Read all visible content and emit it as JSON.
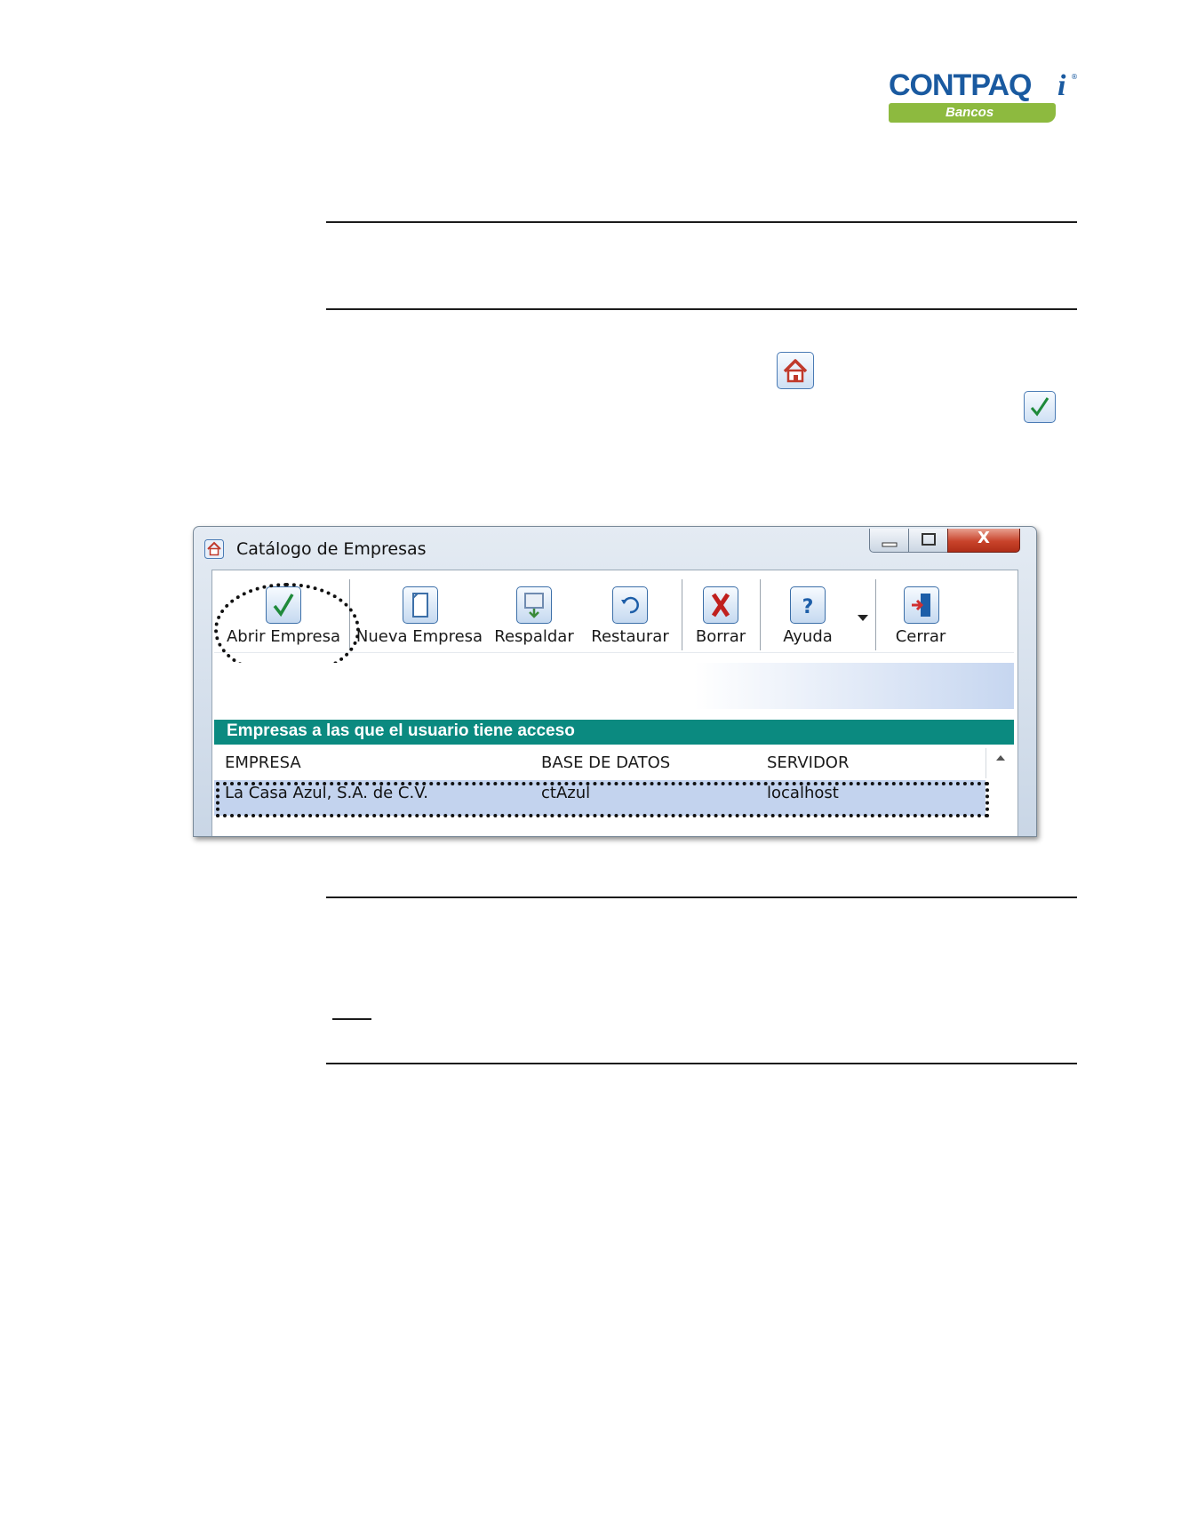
{
  "logo": {
    "word": "CONTPAQ",
    "i": "i",
    "tm": "®",
    "product": "Bancos"
  },
  "window": {
    "title": "Catálogo de Empresas",
    "close_glyph": "X",
    "toolbar": [
      {
        "id": "abrir",
        "label": "Abrir Empresa",
        "icon": "check-icon",
        "color": "#1f8a3a"
      },
      {
        "id": "nueva",
        "label": "Nueva Empresa",
        "icon": "new-document-icon",
        "color": "#3c6fa8"
      },
      {
        "id": "respaldar",
        "label": "Respaldar",
        "icon": "backup-icon",
        "color": "#3a8a3a"
      },
      {
        "id": "restaurar",
        "label": "Restaurar",
        "icon": "restore-icon",
        "color": "#1d5ea8"
      },
      {
        "id": "borrar",
        "label": "Borrar",
        "icon": "delete-x-icon",
        "color": "#c0201e"
      },
      {
        "id": "ayuda",
        "label": "Ayuda",
        "icon": "help-icon",
        "color": "#1d5ea8"
      },
      {
        "id": "cerrar",
        "label": "Cerrar",
        "icon": "exit-door-icon",
        "color": "#1d5ea8"
      }
    ],
    "grid": {
      "caption": "Empresas a las que el usuario tiene acceso",
      "columns": [
        "EMPRESA",
        "BASE DE DATOS",
        "SERVIDOR"
      ],
      "rows": [
        {
          "empresa": "La Casa Azul, S.A. de C.V.",
          "base": "ctAzul",
          "servidor": "localhost"
        }
      ]
    }
  },
  "colors": {
    "accent_teal": "#0b8a80",
    "brand_blue": "#1a5aa0",
    "brand_green": "#8dba3f",
    "row_selected": "#c3d3ee"
  }
}
